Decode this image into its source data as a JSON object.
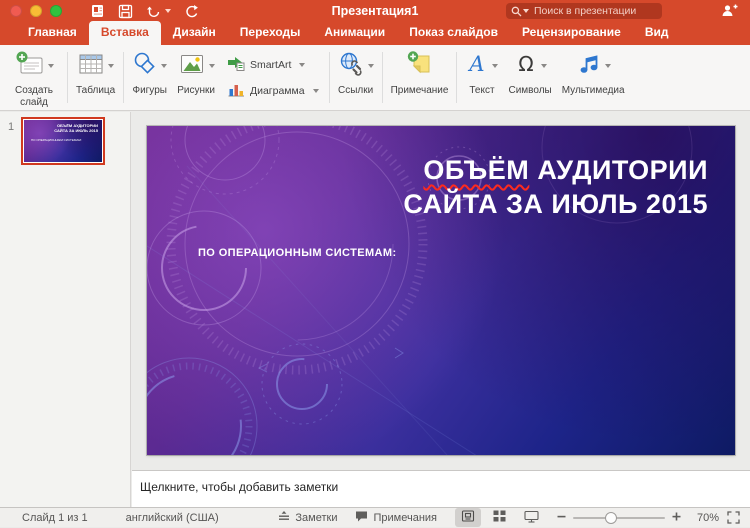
{
  "titlebar": {
    "title": "Презентация1",
    "search_placeholder": "Поиск в презентации"
  },
  "tabs": {
    "items": [
      {
        "label": "Главная",
        "active": false
      },
      {
        "label": "Вставка",
        "active": true
      },
      {
        "label": "Дизайн",
        "active": false
      },
      {
        "label": "Переходы",
        "active": false
      },
      {
        "label": "Анимации",
        "active": false
      },
      {
        "label": "Показ слайдов",
        "active": false
      },
      {
        "label": "Рецензирование",
        "active": false
      },
      {
        "label": "Вид",
        "active": false
      }
    ]
  },
  "ribbon": {
    "new_slide": "Создать слайд",
    "table": "Таблица",
    "shapes": "Фигуры",
    "pictures": "Рисунки",
    "smartart": "SmartArt",
    "chart": "Диаграмма",
    "links": "Ссылки",
    "comment": "Примечание",
    "text": "Текст",
    "symbols": "Символы",
    "media": "Мультимедиа"
  },
  "slide_panel": {
    "slide_number": "1"
  },
  "slide": {
    "title_word": "ОБЪЁМ",
    "title_line1_rest": " АУДИТОРИИ",
    "title_line2": "САЙТА ЗА ИЮЛЬ 2015",
    "subtitle": "ПО ОПЕРАЦИОННЫМ СИСТЕМАМ:"
  },
  "notes": {
    "placeholder": "Щелкните, чтобы добавить заметки"
  },
  "statusbar": {
    "slide_counter": "Слайд 1 из 1",
    "language": "английский (США)",
    "notes_label": "Заметки",
    "comments_label": "Примечания",
    "zoom_level": "70%"
  },
  "colors": {
    "accent": "#d6492b",
    "selection_border": "#d0391f",
    "slide_gradient_purple": "#6f2b93",
    "slide_gradient_blue": "#0e1a63",
    "spellcheck_squiggle": "#ff2a1e"
  }
}
